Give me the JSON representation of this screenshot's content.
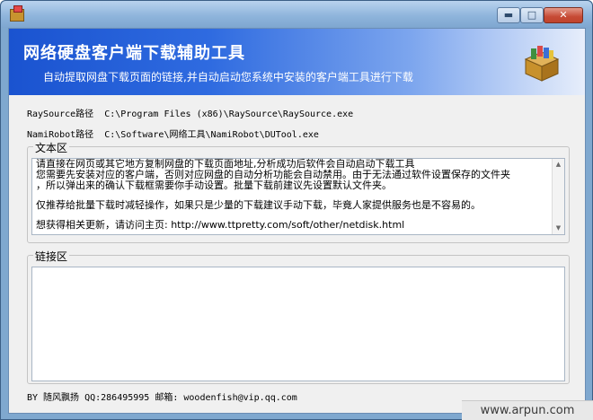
{
  "window": {
    "icon": "gift-box-icon",
    "controls": {
      "minimize": "▬",
      "maximize": "□",
      "close": "✕"
    }
  },
  "banner": {
    "title": "网络硬盘客户端下载辅助工具",
    "subtitle": "自动提取网盘下载页面的链接,并自动启动您系统中安装的客户端工具进行下载",
    "icon": "gift-box-icon"
  },
  "paths": [
    {
      "label": "RaySource路径",
      "value": "C:\\Program Files (x86)\\RaySource\\RaySource.exe"
    },
    {
      "label": "NamiRobot路径",
      "value": "C:\\Software\\网络工具\\NamiRobot\\DUTool.exe"
    }
  ],
  "text_section": {
    "label": "文本区",
    "lines": [
      "请直接在网页或其它地方复制网盘的下载页面地址,分析成功后软件会自动启动下载工具",
      "您需要先安装对应的客户端，否则对应网盘的自动分析功能会自动禁用。由于无法通过软件设置保存的文件夹",
      "，所以弹出来的确认下载框需要你手动设置。批量下载前建议先设置默认文件夹。",
      "",
      "仅推荐给批量下载时减轻操作，如果只是少量的下载建议手动下载，毕竟人家提供服务也是不容易的。",
      "",
      "想获得相关更新，请访问主页:  http://www.ttpretty.com/soft/other/netdisk.html"
    ]
  },
  "links_section": {
    "label": "链接区"
  },
  "footer": {
    "text": "BY 随风飘扬 QQ:286495995 邮箱: woodenfish@vip.qq.com"
  },
  "watermark": {
    "text": "www.arpun.com"
  }
}
